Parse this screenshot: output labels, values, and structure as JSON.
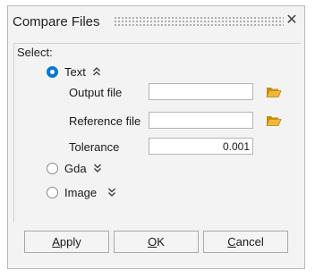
{
  "dialog": {
    "title": "Compare Files",
    "close_glyph": "✕"
  },
  "select": {
    "label": "Select:"
  },
  "options": {
    "text": {
      "label": "Text",
      "checked": true,
      "expand": "collapse-up"
    },
    "gda": {
      "label": "Gda",
      "checked": false,
      "expand": "expand-down"
    },
    "image": {
      "label": "Image",
      "checked": false,
      "expand": "expand-down"
    }
  },
  "text_fields": {
    "output_file": {
      "label": "Output file",
      "value": ""
    },
    "reference_file": {
      "label": "Reference file",
      "value": ""
    },
    "tolerance": {
      "label": "Tolerance",
      "value": "0.001"
    }
  },
  "buttons": {
    "apply": {
      "mnemonic": "A",
      "rest": "pply"
    },
    "ok": {
      "mnemonic": "O",
      "rest": "K"
    },
    "cancel": {
      "mnemonic": "C",
      "rest": "ancel"
    }
  },
  "colors": {
    "accent": "#0a78d7",
    "folder": "#e0a526",
    "dialog_bg": "#f3f3f3"
  }
}
